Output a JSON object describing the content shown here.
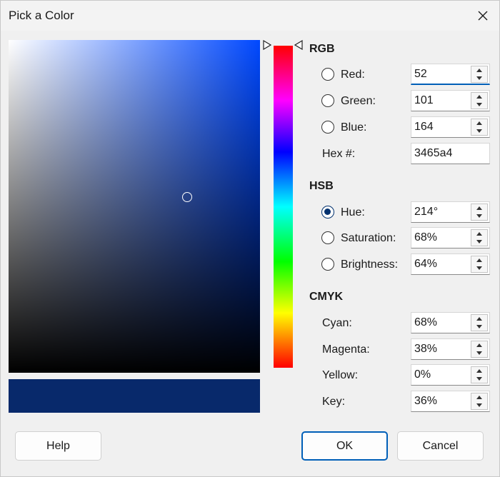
{
  "window": {
    "title": "Pick a Color"
  },
  "picker": {
    "preview_color": "#08296b",
    "base_hue_color": "#0048ff"
  },
  "rgb": {
    "title": "RGB",
    "red": {
      "label": "Red:",
      "value": "52"
    },
    "green": {
      "label": "Green:",
      "value": "101"
    },
    "blue": {
      "label": "Blue:",
      "value": "164"
    },
    "hex": {
      "label": "Hex #:",
      "value": "3465a4"
    }
  },
  "hsb": {
    "title": "HSB",
    "hue": {
      "label": "Hue:",
      "value": "214°",
      "selected": true
    },
    "saturation": {
      "label": "Saturation:",
      "value": "68%"
    },
    "brightness": {
      "label": "Brightness:",
      "value": "64%"
    }
  },
  "cmyk": {
    "title": "CMYK",
    "cyan": {
      "label": "Cyan:",
      "value": "68%"
    },
    "magenta": {
      "label": "Magenta:",
      "value": "38%"
    },
    "yellow": {
      "label": "Yellow:",
      "value": "0%"
    },
    "key": {
      "label": "Key:",
      "value": "36%"
    }
  },
  "buttons": {
    "help": "Help",
    "ok": "OK",
    "cancel": "Cancel"
  },
  "colors": {
    "accent": "#005fb8",
    "radio_selected": "#00306e"
  },
  "icons": {
    "close": "close-icon",
    "hue_marker": "triangle-marker-icon"
  }
}
